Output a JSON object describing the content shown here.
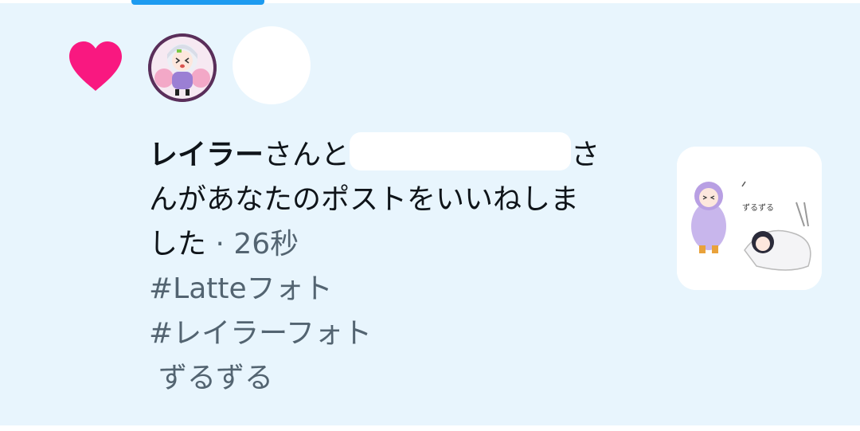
{
  "notification": {
    "icon": "heart-icon",
    "icon_color": "#f91880",
    "actor_name": "レイラー",
    "text_san_to": "さんと",
    "text_san": "さ",
    "text_line2": "んがあなたのポストをいいねしま",
    "text_line3": "した",
    "separator": "·",
    "time": "26秒",
    "post_lines": [
      "#Latteフォト",
      "#レイラーフォト",
      "ずるずる"
    ]
  },
  "colors": {
    "panel_bg": "#e8f5fd",
    "accent": "#1d9bf0",
    "text_primary": "#0f1419",
    "text_secondary": "#536471"
  }
}
